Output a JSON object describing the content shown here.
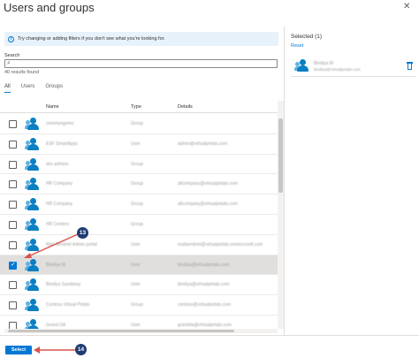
{
  "header": {
    "title": "Users and groups",
    "close_glyph": "✕"
  },
  "info": {
    "icon": "info-icon",
    "text": "Try changing or adding filters if you don't see what you're looking for."
  },
  "search": {
    "label": "Search",
    "placeholder": "",
    "results_text": "40 results found"
  },
  "tabs": [
    {
      "label": "All",
      "active": true
    },
    {
      "label": "Users",
      "active": false
    },
    {
      "label": "Groups",
      "active": false
    }
  ],
  "table": {
    "columns": [
      "Name",
      "Type",
      "Details"
    ],
    "rows": [
      {
        "name": "commongems",
        "type": "Group",
        "details": "",
        "selected": false
      },
      {
        "name": "ESF SmartApps",
        "type": "User",
        "details": "admin@virtualpetals.com",
        "selected": false
      },
      {
        "name": "dss admins",
        "type": "Group",
        "details": "",
        "selected": false
      },
      {
        "name": "HR Company",
        "type": "Group",
        "details": "allcompany@virtualpetals.com",
        "selected": false
      },
      {
        "name": "HR Company",
        "type": "Group",
        "details": "allcompany@virtualpetals.com",
        "selected": false
      },
      {
        "name": "HR Centers",
        "type": "Group",
        "details": "",
        "selected": false
      },
      {
        "name": "Mail Sentinel Admin portal",
        "type": "User",
        "details": "mailsentinel@virtualpetals.onmicrosoft.com",
        "selected": false
      },
      {
        "name": "Bindiya M",
        "type": "User",
        "details": "bindiya@virtualpetals.com",
        "selected": true
      },
      {
        "name": "Bindiya Sundaray",
        "type": "User",
        "details": "bindiya@virtualpetals.com",
        "selected": false
      },
      {
        "name": "Contoso Virtual Petals",
        "type": "Group",
        "details": "contoso@virtualpetals.com",
        "selected": false
      },
      {
        "name": "Grand DA",
        "type": "User",
        "details": "grandda@virtualpetals.com",
        "selected": false
      }
    ]
  },
  "selected_panel": {
    "title": "Selected (1)",
    "reset_label": "Reset",
    "item": {
      "name": "Bindiya M",
      "email": "bindiya@virtualpetals.com",
      "remove_icon": "trash-icon"
    }
  },
  "footer": {
    "select_label": "Select"
  },
  "callouts": {
    "first": "13",
    "second": "14"
  },
  "colors": {
    "accent": "#0078d4",
    "callout": "#1f3b73",
    "arrow": "#d9534f"
  },
  "check_glyph": "✓",
  "search_glyph": "⌕"
}
